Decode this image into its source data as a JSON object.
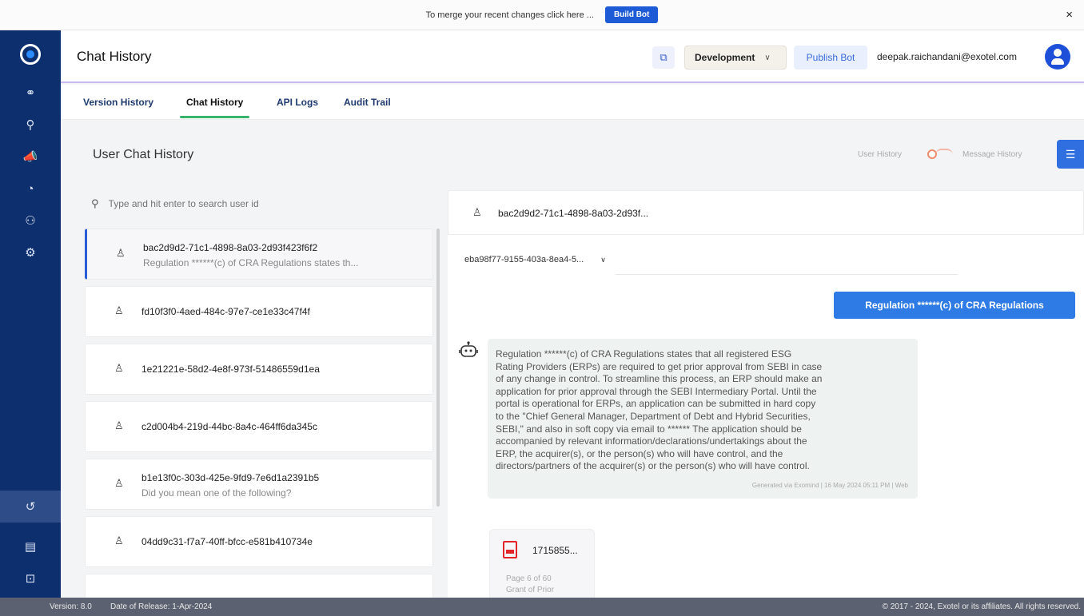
{
  "banner": {
    "message": "To merge your recent changes click here ...",
    "build_button": "Build Bot",
    "close_icon": "×"
  },
  "sidebar": {
    "logo": "exotel-logo",
    "items": [
      {
        "icon": "flow-icon",
        "glyph": "⚭"
      },
      {
        "icon": "integrations-icon",
        "glyph": "⚲"
      },
      {
        "icon": "campaign-icon",
        "glyph": "📣"
      },
      {
        "icon": "analytics-icon",
        "glyph": "◔"
      },
      {
        "icon": "users-icon",
        "glyph": "⚇"
      },
      {
        "icon": "settings-icon",
        "glyph": "⚙"
      }
    ],
    "bottom_items": [
      {
        "icon": "history-icon",
        "glyph": "↺",
        "active": true
      },
      {
        "icon": "docs-icon",
        "glyph": "▤",
        "active": false
      },
      {
        "icon": "collapse-icon",
        "glyph": "⊡",
        "active": false
      }
    ]
  },
  "header": {
    "title": "Chat History",
    "copy_icon": "copy-icon",
    "environment": "Development",
    "publish_label": "Publish Bot",
    "user_email": "deepak.raichandani@exotel.com"
  },
  "tabs": [
    {
      "label": "Version History",
      "active": false
    },
    {
      "label": "Chat History",
      "active": true
    },
    {
      "label": "API Logs",
      "active": false
    },
    {
      "label": "Audit Trail",
      "active": false
    }
  ],
  "main": {
    "title": "User Chat History",
    "toggle_left": "User History",
    "toggle_right": "Message History"
  },
  "search": {
    "placeholder": "Type and hit enter to search user id"
  },
  "users": [
    {
      "id": "bac2d9d2-71c1-4898-8a03-2d93f423f6f2",
      "preview": "Regulation ******(c) of CRA Regulations states th...",
      "active": true
    },
    {
      "id": "fd10f3f0-4aed-484c-97e7-ce1e33c47f4f",
      "preview": "",
      "active": false
    },
    {
      "id": "1e21221e-58d2-4e8f-973f-51486559d1ea",
      "preview": "",
      "active": false
    },
    {
      "id": "c2d004b4-219d-44bc-8a4c-464ff6da345c",
      "preview": "",
      "active": false
    },
    {
      "id": "b1e13f0c-303d-425e-9fd9-7e6d1a2391b5",
      "preview": "Did you mean one of the following?",
      "active": false
    },
    {
      "id": "04dd9c31-f7a7-40ff-bfcc-e581b410734e",
      "preview": "",
      "active": false
    }
  ],
  "conversation": {
    "user_id": "bac2d9d2-71c1-4898-8a03-2d93f...",
    "session_id": "eba98f77-9155-403a-8ea4-5...",
    "user_message": "Regulation ******(c) of CRA Regulations",
    "bot_lines": [
      "Regulation ******(c) of CRA Regulations states that all registered ESG",
      "Rating Providers (ERPs) are required to get prior approval from SEBI in case",
      "of any change in control. To streamline this process, an ERP should make an",
      "application for prior approval through the SEBI Intermediary Portal. Until the",
      "portal is operational for ERPs, an application can be submitted in hard copy",
      "to the \"Chief General Manager, Department of Debt and Hybrid Securities,",
      "SEBI,\" and also in soft copy via email to ****** The application should be",
      "accompanied by relevant information/declarations/undertakings about the",
      "ERP, the acquirer(s), or the person(s) who will have control, and the",
      "directors/partners of the acquirer(s) or the person(s) who will have control."
    ],
    "bot_meta": "Generated via Exomind | 16 May 2024 05:11 PM | Web",
    "attachment": {
      "name": "1715855...",
      "page": "Page 6 of 60",
      "snippet": "Grant of Prior"
    }
  },
  "footer": {
    "version": "Version: 8.0",
    "release": "Date of Release: 1-Apr-2024",
    "copyright": "© 2017 - 2024, Exotel or its affiliates. All rights reserved."
  }
}
